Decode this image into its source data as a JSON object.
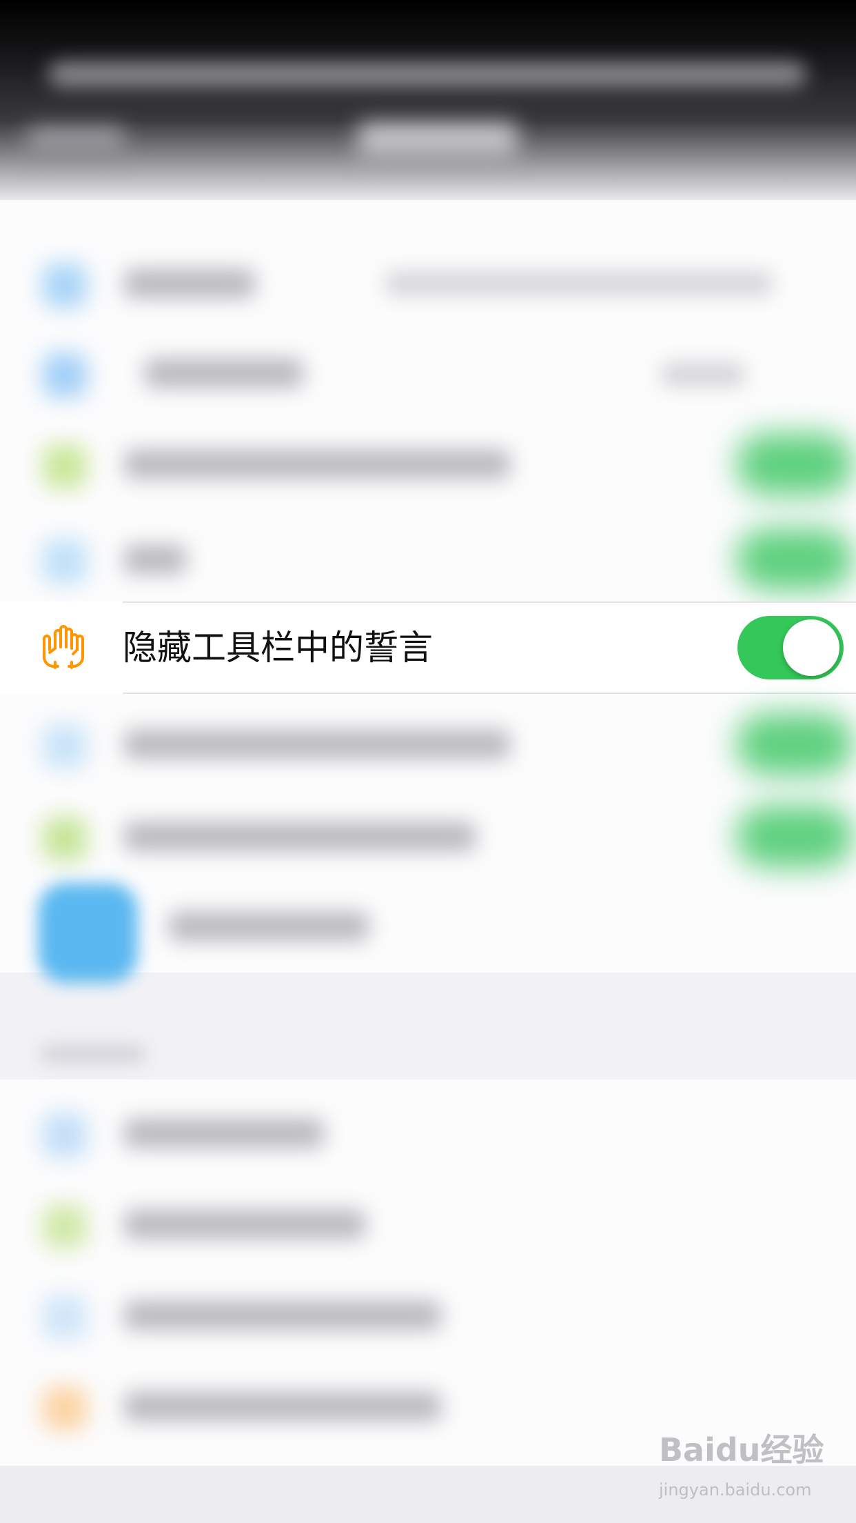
{
  "setting_row": {
    "label": "隐藏工具栏中的誓言",
    "icon": "raised-hands-icon",
    "icon_color": "#ff9500",
    "toggle_on": true,
    "toggle_color": "#34c759"
  },
  "watermark": {
    "logo": "Baidu经验",
    "url": "jingyan.baidu.com"
  },
  "colors": {
    "background": "#f2f2f6",
    "list_background": "#fcfcfd",
    "header_top": "#000000"
  }
}
